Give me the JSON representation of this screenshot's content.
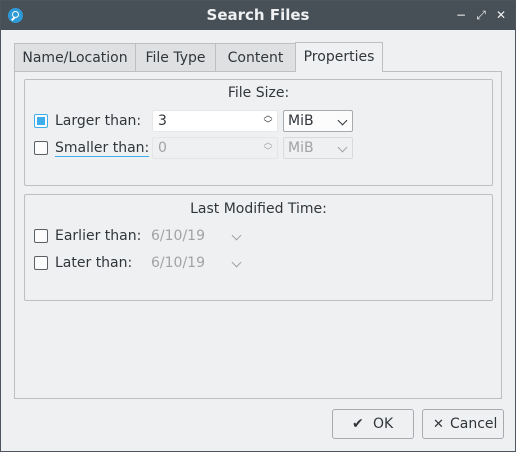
{
  "window": {
    "title": "Search Files"
  },
  "titlebar_buttons": {
    "minimize": "−",
    "maximize": "⤢",
    "close": "✕"
  },
  "tabs": [
    {
      "label": "Name/Location"
    },
    {
      "label": "File Type"
    },
    {
      "label": "Content"
    },
    {
      "label": "Properties",
      "active": true
    }
  ],
  "file_size": {
    "title": "File Size:",
    "larger": {
      "label": "Larger than:",
      "checked": true,
      "value": "3",
      "unit": "MiB"
    },
    "smaller": {
      "label": "Smaller than:",
      "checked": false,
      "value": "0",
      "unit": "MiB"
    }
  },
  "modified": {
    "title": "Last Modified Time:",
    "earlier": {
      "label": "Earlier than:",
      "checked": false,
      "date": "6/10/19"
    },
    "later": {
      "label": "Later than:",
      "checked": false,
      "date": "6/10/19"
    }
  },
  "buttons": {
    "ok": "OK",
    "ok_icon": "checkmark-icon",
    "cancel": "Cancel",
    "cancel_icon": "close-icon"
  },
  "colors": {
    "accent": "#3daee9",
    "titlebar": "#475057",
    "window_bg": "#eff0f1"
  }
}
